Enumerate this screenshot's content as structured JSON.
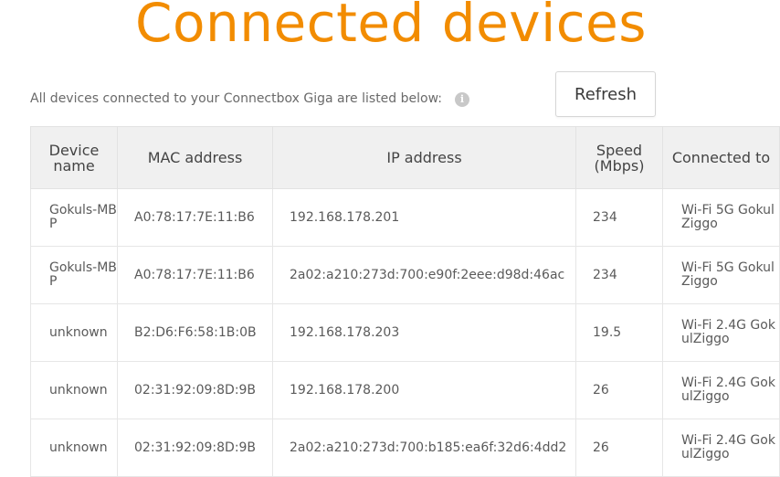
{
  "page": {
    "title": "Connected devices",
    "intro": "All devices connected to your Connectbox Giga are listed below:",
    "info_icon": "i",
    "refresh_label": "Refresh",
    "accent_color": "#f28c00"
  },
  "table": {
    "headers": {
      "device_name": "Device name",
      "mac": "MAC address",
      "ip": "IP address",
      "speed": "Speed (Mbps)",
      "connected_to": "Connected to"
    },
    "rows": [
      {
        "device_name": "Gokuls-MBP",
        "mac": "A0:78:17:7E:11:B6",
        "ip": "192.168.178.201",
        "speed": "234",
        "connected_to": "Wi-Fi 5G GokulZiggo"
      },
      {
        "device_name": "Gokuls-MBP",
        "mac": "A0:78:17:7E:11:B6",
        "ip": "2a02:a210:273d:700:e90f:2eee:d98d:46ac",
        "speed": "234",
        "connected_to": "Wi-Fi 5G GokulZiggo"
      },
      {
        "device_name": "unknown",
        "mac": "B2:D6:F6:58:1B:0B",
        "ip": "192.168.178.203",
        "speed": "19.5",
        "connected_to": "Wi-Fi 2.4G GokulZiggo"
      },
      {
        "device_name": "unknown",
        "mac": "02:31:92:09:8D:9B",
        "ip": "192.168.178.200",
        "speed": "26",
        "connected_to": "Wi-Fi 2.4G GokulZiggo"
      },
      {
        "device_name": "unknown",
        "mac": "02:31:92:09:8D:9B",
        "ip": "2a02:a210:273d:700:b185:ea6f:32d6:4dd2",
        "speed": "26",
        "connected_to": "Wi-Fi 2.4G GokulZiggo"
      }
    ]
  }
}
